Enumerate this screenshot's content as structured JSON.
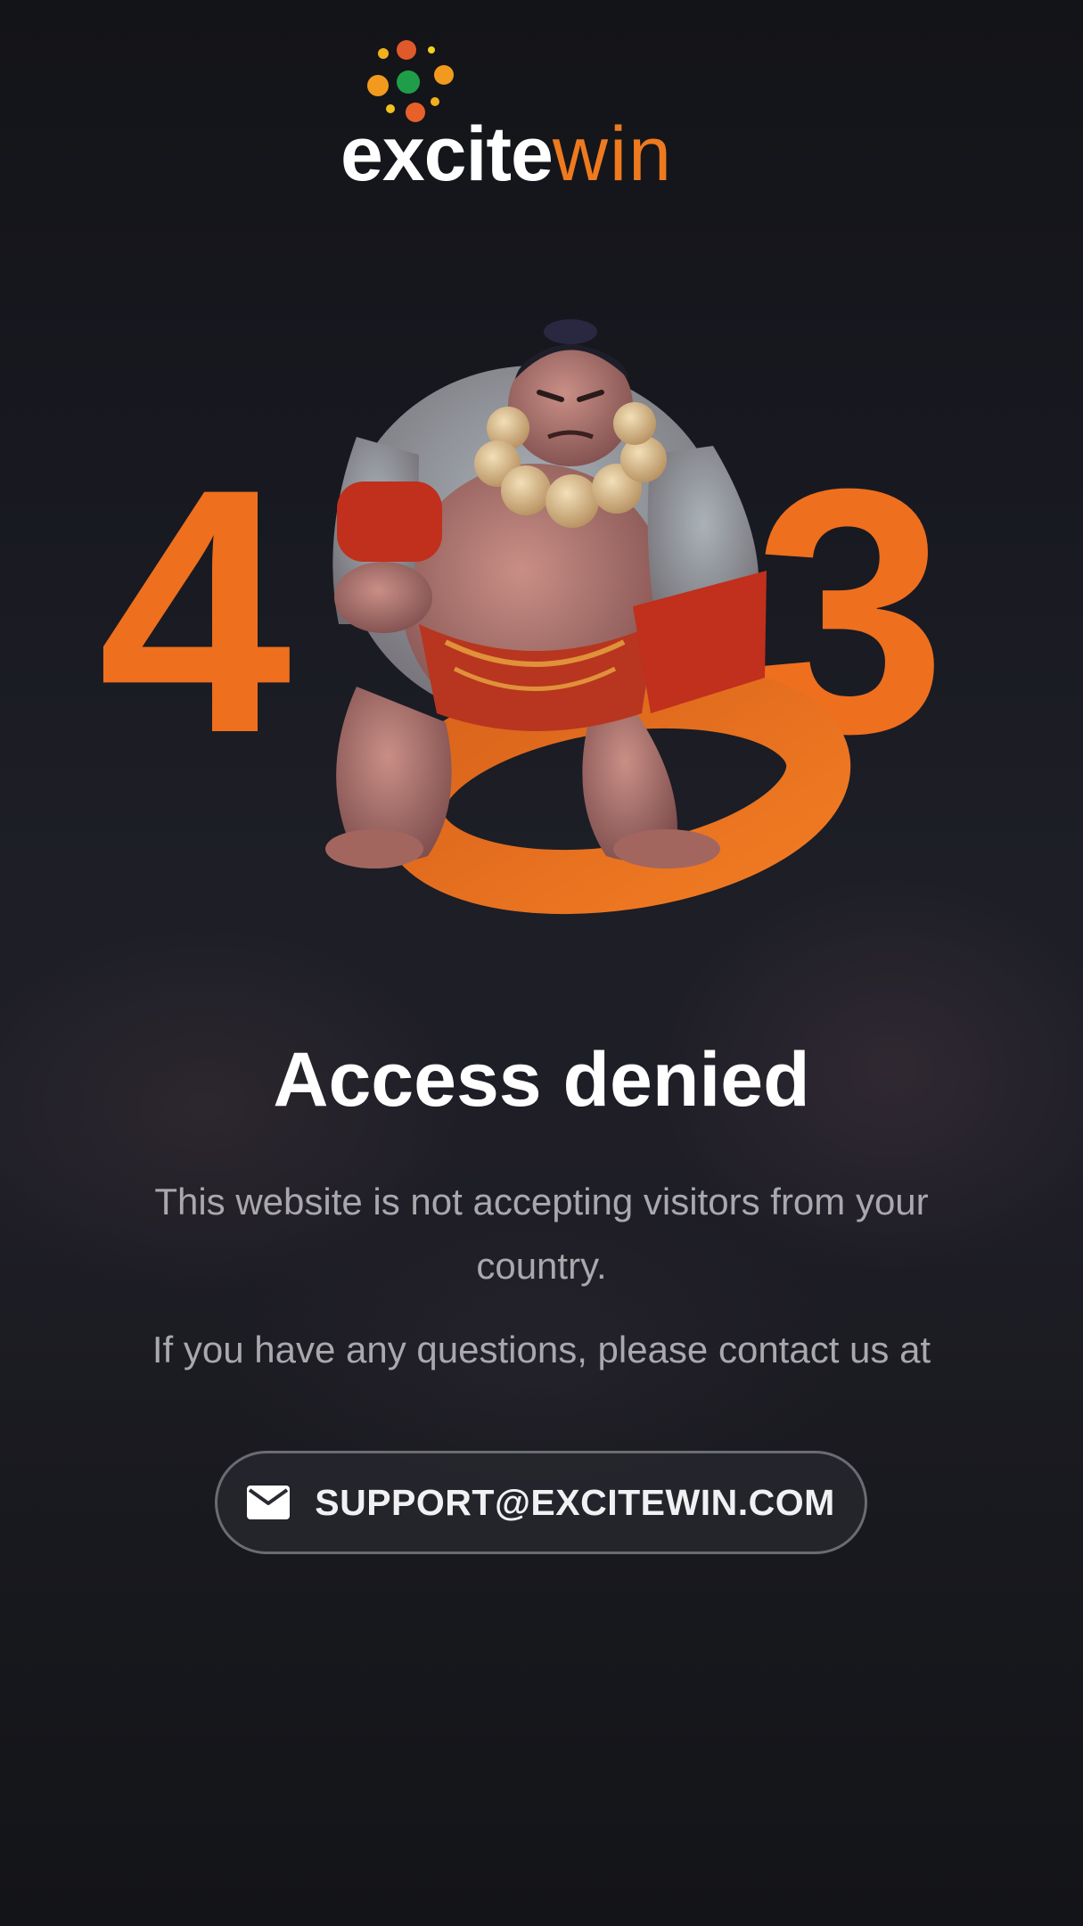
{
  "logo": {
    "text_left": "excite",
    "text_right": "win"
  },
  "hero": {
    "digit_left": "4",
    "digit_middle": "0",
    "digit_right": "3"
  },
  "content": {
    "title": "Access denied",
    "message": "This website is not accepting visitors from your country.",
    "contact": "If you have any questions, please contact us at"
  },
  "email_button": {
    "icon": "envelope-icon",
    "label": "SUPPORT@EXCITEWIN.COM"
  },
  "colors": {
    "brand_orange": "#ee7a1f",
    "background": "#16171c",
    "title": "#ffffff",
    "body_text": "#a9a8ad"
  }
}
